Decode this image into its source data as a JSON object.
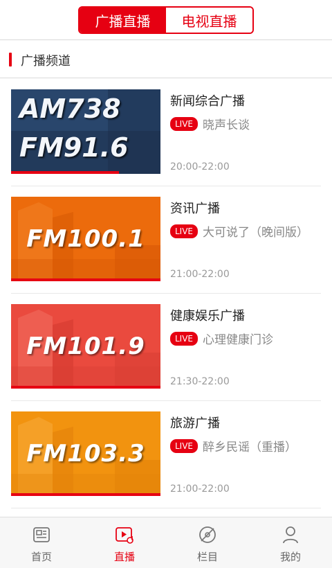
{
  "tabs": {
    "radio_label": "广播直播",
    "tv_label": "电视直播",
    "active": "radio"
  },
  "section": {
    "title": "广播频道"
  },
  "channels": [
    {
      "name": "新闻综合广播",
      "live_badge": "LIVE",
      "program": "晓声长谈",
      "time": "20:00-22:00",
      "thumb_line1": "AM738",
      "thumb_line2": "FM91.6",
      "thumb_theme": "blue"
    },
    {
      "name": "资讯广播",
      "live_badge": "LIVE",
      "program": "大可说了（晚间版）",
      "time": "21:00-22:00",
      "thumb_line1": "FM100.1",
      "thumb_theme": "orange"
    },
    {
      "name": "健康娱乐广播",
      "live_badge": "LIVE",
      "program": "心理健康门诊",
      "time": "21:30-22:00",
      "thumb_line1": "FM101.9",
      "thumb_theme": "red"
    },
    {
      "name": "旅游广播",
      "live_badge": "LIVE",
      "program": "醉乡民谣（重播）",
      "time": "21:00-22:00",
      "thumb_line1": "FM103.3",
      "thumb_theme": "amber"
    }
  ],
  "nav": [
    {
      "label": "首页",
      "icon": "news-icon",
      "active": false
    },
    {
      "label": "直播",
      "icon": "live-video-icon",
      "active": true
    },
    {
      "label": "栏目",
      "icon": "column-disc-icon",
      "active": false
    },
    {
      "label": "我的",
      "icon": "user-icon",
      "active": false
    }
  ],
  "colors": {
    "accent": "#e60012",
    "text": "#222222",
    "muted": "#888888"
  }
}
